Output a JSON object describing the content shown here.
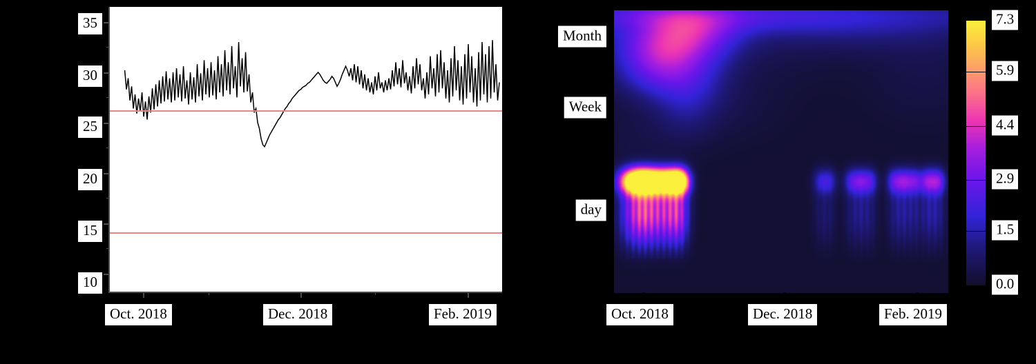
{
  "figure": {
    "background_color": "#000000",
    "panel_background": "#ffffff"
  },
  "left_panel": {
    "name": "time-series-plot",
    "y_ticks": [
      "35",
      "30",
      "25",
      "20",
      "15",
      "10"
    ],
    "y_tick_values": [
      35,
      30,
      25,
      20,
      15,
      10
    ],
    "x_ticks": [
      "Oct. 2018",
      "Dec. 2018",
      "Feb. 2019"
    ],
    "threshold_color": "#e8877f",
    "series_color": "#000000"
  },
  "right_panel": {
    "name": "wavelet-scalogram",
    "y_ticks": [
      "Month",
      "Week",
      "day"
    ],
    "x_ticks": [
      "Oct. 2018",
      "Dec. 2018",
      "Feb. 2019"
    ],
    "colorbar_ticks": [
      "7.3",
      "5.9",
      "4.4",
      "2.9",
      "1.5",
      "0.0"
    ],
    "colorbar_values": [
      7.3,
      5.9,
      4.4,
      2.9,
      1.5,
      0.0
    ]
  },
  "chart_data": [
    {
      "type": "line",
      "title": "",
      "xlabel": "",
      "ylabel": "",
      "xlim": [
        "2018-09-15",
        "2019-03-01"
      ],
      "ylim": [
        8.2,
        36.5
      ],
      "grid": false,
      "legend": "none",
      "x_tick_labels": [
        "Oct. 2018",
        "Dec. 2018",
        "Feb. 2019"
      ],
      "x_tick_positions_frac": [
        0.0845,
        0.4859,
        0.912
      ],
      "y_tick_labels": [
        "35",
        "30",
        "25",
        "20",
        "15",
        "10"
      ],
      "y_tick_values": [
        35,
        30,
        25,
        20,
        15,
        10
      ],
      "annotations": [
        {
          "type": "hline",
          "value": 26.2,
          "color": "#e8877f"
        },
        {
          "type": "hline",
          "value": 14.1,
          "color": "#e8877f"
        }
      ],
      "series": [
        {
          "name": "signal",
          "color": "#000000",
          "description": "Daily oscillating series: strong diurnal swings Sept-Oct around 28, a sharp drop to 22.5 in late Oct, a gradual recovery through Nov-Dec to ~29, then renewed large daily oscillation Jan-Feb between 26 and 33.",
          "values": [
            30.2,
            28.3,
            29.4,
            27.2,
            28.6,
            26.4,
            27.8,
            25.9,
            27.4,
            26.1,
            28.0,
            25.6,
            27.1,
            25.3,
            27.6,
            26.0,
            28.4,
            26.3,
            28.8,
            26.6,
            29.2,
            26.9,
            29.6,
            27.1,
            30.1,
            27.3,
            29.4,
            27.0,
            30.0,
            27.2,
            30.4,
            27.5,
            29.8,
            27.1,
            30.6,
            27.4,
            29.2,
            26.8,
            30.0,
            27.3,
            29.5,
            27.0,
            30.8,
            27.6,
            29.9,
            27.2,
            31.2,
            27.8,
            30.4,
            27.5,
            31.0,
            27.7,
            30.2,
            27.3,
            31.6,
            28.0,
            30.8,
            27.6,
            32.2,
            28.2,
            31.0,
            27.8,
            32.6,
            28.4,
            30.6,
            27.5,
            33.0,
            28.6,
            31.4,
            28.0,
            32.0,
            28.1,
            29.8,
            27.0,
            28.0,
            26.0,
            26.4,
            25.0,
            24.4,
            23.4,
            22.8,
            22.6,
            23.0,
            23.4,
            23.8,
            24.1,
            24.4,
            24.7,
            25.0,
            25.3,
            25.5,
            25.8,
            26.1,
            26.4,
            26.6,
            26.9,
            27.1,
            27.4,
            27.6,
            27.8,
            28.0,
            28.2,
            28.3,
            28.5,
            28.6,
            28.7,
            28.9,
            29.0,
            29.2,
            29.4,
            29.6,
            29.8,
            30.0,
            29.8,
            29.5,
            29.2,
            29.0,
            28.9,
            29.1,
            29.3,
            29.6,
            29.4,
            29.0,
            28.6,
            28.9,
            29.3,
            29.8,
            30.2,
            30.6,
            30.2,
            29.6,
            30.4,
            29.2,
            30.8,
            29.0,
            30.6,
            28.8,
            30.2,
            28.4,
            29.8,
            28.2,
            29.4,
            28.0,
            29.0,
            27.8,
            29.6,
            28.2,
            30.0,
            28.4,
            29.0,
            28.0,
            29.2,
            28.2,
            29.4,
            28.3,
            30.2,
            28.6,
            31.0,
            28.8,
            30.4,
            28.5,
            31.2,
            28.9,
            30.0,
            28.2,
            29.6,
            27.9,
            30.6,
            28.4,
            31.4,
            28.8,
            30.8,
            28.2,
            29.4,
            27.4,
            30.0,
            27.8,
            31.6,
            28.4,
            30.4,
            27.6,
            31.8,
            28.0,
            32.2,
            28.4,
            31.0,
            27.4,
            30.2,
            27.0,
            31.4,
            27.6,
            32.6,
            28.2,
            31.2,
            27.2,
            30.6,
            26.8,
            31.8,
            27.4,
            32.8,
            28.0,
            31.6,
            27.0,
            30.4,
            26.6,
            32.0,
            27.2,
            33.0,
            27.8,
            31.8,
            27.0,
            32.6,
            27.4,
            33.2,
            28.0,
            30.8,
            27.2,
            29.0
          ]
        }
      ]
    },
    {
      "type": "heatmap",
      "title": "",
      "xlabel": "",
      "ylabel": "",
      "grid": false,
      "colormap": "plasma-like (dark navy -> blue -> purple -> magenta -> orange -> yellow)",
      "colorbar_label": "",
      "zlim": [
        0.0,
        7.3
      ],
      "colorbar_ticks": [
        0.0,
        1.5,
        2.9,
        4.4,
        5.9,
        7.3
      ],
      "y_tick_labels": [
        "Month",
        "Week",
        "day"
      ],
      "y_tick_positions_frac": [
        0.094,
        0.345,
        0.71
      ],
      "x_tick_labels": [
        "Oct. 2018",
        "Dec. 2018",
        "Feb. 2019"
      ],
      "x_tick_positions_frac": [
        0.0888,
        0.5103,
        0.907
      ],
      "features": [
        {
          "name": "daily-band-strong",
          "x_frac_range": [
            0.03,
            0.22
          ],
          "y_frac": 0.605,
          "peak_value": 7.3
        },
        {
          "name": "daily-band-weak-winter",
          "x_frac_range": [
            0.62,
            0.99
          ],
          "y_frac": 0.605,
          "peak_value": 3.0
        },
        {
          "name": "month-scale-blob",
          "x_frac_range": [
            0.0,
            0.4
          ],
          "y_frac_range": [
            0.0,
            0.3
          ],
          "peak_value": 2.6
        },
        {
          "name": "top-edge-ridge",
          "x_frac_range": [
            0.0,
            1.0
          ],
          "y_frac": 0.02,
          "peak_value": 1.6
        }
      ]
    }
  ]
}
